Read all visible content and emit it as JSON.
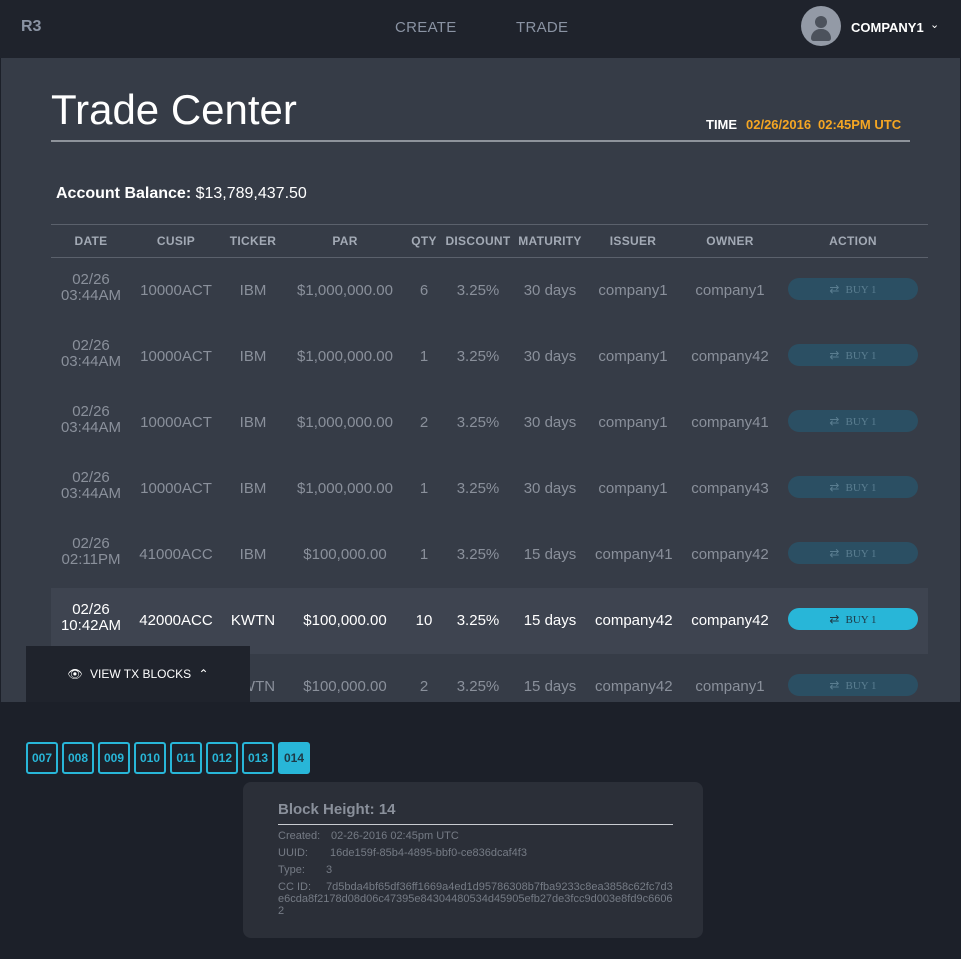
{
  "nav": {
    "logo": "R3",
    "create": "CREATE",
    "trade": "TRADE",
    "user": "COMPANY1",
    "chevron": "⌄"
  },
  "page": {
    "title": "Trade Center",
    "time_label": "TIME",
    "time_date": "02/26/2016",
    "time_clock": "02:45PM UTC",
    "balance_label": "Account Balance:",
    "balance_value": "$13,789,437.50"
  },
  "table": {
    "headers": [
      "DATE",
      "CUSIP",
      "TICKER",
      "PAR",
      "QTY",
      "DISCOUNT",
      "MATURITY",
      "ISSUER",
      "OWNER",
      "ACTION"
    ],
    "rows": [
      {
        "date": "02/26",
        "time": "03:44AM",
        "cusip": "10000ACT",
        "ticker": "IBM",
        "par": "$1,000,000.00",
        "qty": "6",
        "discount": "3.25%",
        "maturity": "30 days",
        "issuer": "company1",
        "owner": "company1",
        "action": "BUY 1"
      },
      {
        "date": "02/26",
        "time": "03:44AM",
        "cusip": "10000ACT",
        "ticker": "IBM",
        "par": "$1,000,000.00",
        "qty": "1",
        "discount": "3.25%",
        "maturity": "30 days",
        "issuer": "company1",
        "owner": "company42",
        "action": "BUY 1"
      },
      {
        "date": "02/26",
        "time": "03:44AM",
        "cusip": "10000ACT",
        "ticker": "IBM",
        "par": "$1,000,000.00",
        "qty": "2",
        "discount": "3.25%",
        "maturity": "30 days",
        "issuer": "company1",
        "owner": "company41",
        "action": "BUY 1"
      },
      {
        "date": "02/26",
        "time": "03:44AM",
        "cusip": "10000ACT",
        "ticker": "IBM",
        "par": "$1,000,000.00",
        "qty": "1",
        "discount": "3.25%",
        "maturity": "30 days",
        "issuer": "company1",
        "owner": "company43",
        "action": "BUY 1"
      },
      {
        "date": "02/26",
        "time": "02:11PM",
        "cusip": "41000ACC",
        "ticker": "IBM",
        "par": "$100,000.00",
        "qty": "1",
        "discount": "3.25%",
        "maturity": "15 days",
        "issuer": "company41",
        "owner": "company42",
        "action": "BUY 1"
      },
      {
        "date": "02/26",
        "time": "10:42AM",
        "cusip": "42000ACC",
        "ticker": "KWTN",
        "par": "$100,000.00",
        "qty": "10",
        "discount": "3.25%",
        "maturity": "15 days",
        "issuer": "company42",
        "owner": "company42",
        "action": "BUY 1"
      },
      {
        "date": "",
        "time": "",
        "cusip": "",
        "ticker": "KWTN",
        "par": "$100,000.00",
        "qty": "2",
        "discount": "3.25%",
        "maturity": "15 days",
        "issuer": "company42",
        "owner": "company1",
        "action": "BUY 1"
      }
    ],
    "highlighted_row": 5
  },
  "tx": {
    "toggle_label": "VIEW TX BLOCKS",
    "toggle_chevron": "⌃",
    "blocks": [
      "007",
      "008",
      "009",
      "010",
      "011",
      "012",
      "013",
      "014"
    ],
    "active_block": "014",
    "detail": {
      "title": "Block Height: 14",
      "created_label": "Created:",
      "created": "02-26-2016 02:45pm UTC",
      "uuid_label": "UUID:",
      "uuid": "16de159f-85b4-4895-bbf0-ce836dcaf4f3",
      "type_label": "Type:",
      "type": "3",
      "ccid_label": "CC ID:",
      "ccid": "7d5bda4bf65df36ff1669a4ed1d95786308b7fba9233c8ea3858c62fc7d3e6cda8f2178d08d06c47395e84304480534d45905efb27de3fcc9d003e8fd9c66062"
    },
    "accent_color": "#28b6d8"
  }
}
